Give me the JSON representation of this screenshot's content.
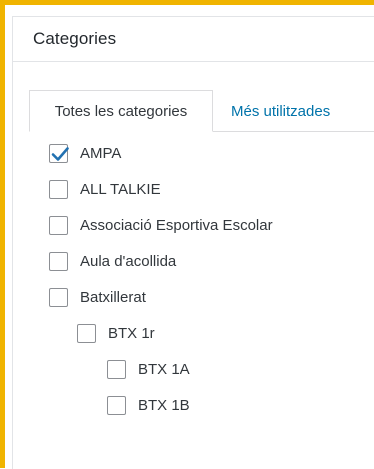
{
  "panel": {
    "title": "Categories"
  },
  "tabs": [
    {
      "label": "Totes les categories",
      "active": true
    },
    {
      "label": "Més utilitzades",
      "active": false
    }
  ],
  "categories": [
    {
      "label": "AMPA",
      "checked": true,
      "level": 0
    },
    {
      "label": "ALL TALKIE",
      "checked": false,
      "level": 0
    },
    {
      "label": "Associació Esportiva Escolar",
      "checked": false,
      "level": 0
    },
    {
      "label": "Aula d'acollida",
      "checked": false,
      "level": 0
    },
    {
      "label": "Batxillerat",
      "checked": false,
      "level": 0
    },
    {
      "label": "BTX 1r",
      "checked": false,
      "level": 1
    },
    {
      "label": "BTX 1A",
      "checked": false,
      "level": 2
    },
    {
      "label": "BTX 1B",
      "checked": false,
      "level": 2
    }
  ],
  "colors": {
    "highlight_border": "#f0b400",
    "link": "#0073aa",
    "checkmark": "#2271b1"
  }
}
